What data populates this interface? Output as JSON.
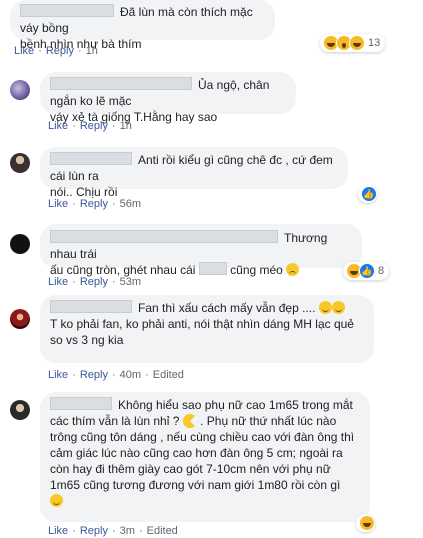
{
  "comments": [
    {
      "text1": "Đã lùn mà còn thích mặc váy bồng",
      "text2": "bềnh nhìn như bà thím",
      "like": "Like",
      "reply": "Reply",
      "time": "1h",
      "reactions": {
        "icons": [
          "haha-icon",
          "wow-icon",
          "haha-icon"
        ],
        "count": "13"
      }
    },
    {
      "text1": "Ủa ngộ, chân ngắn ko lẽ mặc",
      "text2": "váy xẻ tà giống T.Hằng hay sao",
      "like": "Like",
      "reply": "Reply",
      "time": "1h"
    },
    {
      "text1": "Anti rồi kiểu gì cũng chê đc , cứ đem cái lùn ra",
      "text2": "nói.. Chịu rồi",
      "like": "Like",
      "reply": "Reply",
      "time": "56m",
      "reactions": {
        "icons": [
          "like-icon"
        ],
        "count": ""
      }
    },
    {
      "text1": "Thương nhau trái",
      "text2a": "ấu cũng tròn, ghét nhau cái",
      "text2b": "cũng méo",
      "like": "Like",
      "reply": "Reply",
      "time": "53m",
      "reactions": {
        "icons": [
          "haha-icon",
          "like-icon"
        ],
        "count": "8"
      }
    },
    {
      "text1": "Fan thì xấu cách mấy vẫn đẹp ....",
      "text2": "T ko phải fan, ko phải anti, nói thật nhìn dáng MH lạc quẻ",
      "text3": "so vs 3 ng kia",
      "like": "Like",
      "reply": "Reply",
      "time": "40m",
      "edited": "Edited"
    },
    {
      "text1": "Không hiểu sao phụ nữ cao 1m65 trong mắt",
      "text2": "các thím vẫn là lùn nhỉ ?",
      "text2b": ". Phụ nữ thứ nhất lúc nào",
      "text3": "trông cũng tôn dáng , nếu cùng chiều cao với đàn ông thì",
      "text4": "cảm giác lúc nào cũng cao hơn đàn ông 5 cm; ngoài ra",
      "text5": "còn hay đi thêm giày cao gót 7-10cm nên với phụ nữ",
      "text6": "1m65 cũng tương đương với nam giới 1m80 rồi còn gì",
      "like": "Like",
      "reply": "Reply",
      "time": "3m",
      "edited": "Edited",
      "reactions": {
        "icons": [
          "haha-icon"
        ],
        "count": ""
      }
    }
  ]
}
